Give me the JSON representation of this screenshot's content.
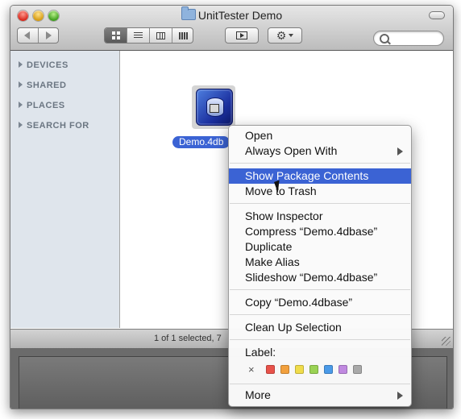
{
  "window": {
    "title": "UnitTester Demo"
  },
  "toolbar": {
    "back_icon": "back-arrow-icon",
    "forward_icon": "forward-arrow-icon",
    "view_modes": [
      "icon-view",
      "list-view",
      "column-view",
      "coverflow-view"
    ],
    "selected_view": "icon-view",
    "quicklook_icon": "quicklook-icon",
    "action_icon": "gear-icon",
    "search_placeholder": ""
  },
  "sidebar": {
    "items": [
      {
        "label": "DEVICES"
      },
      {
        "label": "SHARED"
      },
      {
        "label": "PLACES"
      },
      {
        "label": "SEARCH FOR"
      }
    ]
  },
  "content": {
    "file": {
      "label": "Demo.4db",
      "icon": "4d-database-icon"
    }
  },
  "status": {
    "text": "1 of 1 selected, 7"
  },
  "context_menu": {
    "open": "Open",
    "always_open_with": "Always Open With",
    "show_package_contents": "Show Package Contents",
    "move_to_trash": "Move to Trash",
    "show_inspector": "Show Inspector",
    "compress": "Compress “Demo.4dbase”",
    "duplicate": "Duplicate",
    "make_alias": "Make Alias",
    "slideshow": "Slideshow “Demo.4dbase”",
    "copy": "Copy “Demo.4dbase”",
    "clean_up_selection": "Clean Up Selection",
    "label_title": "Label:",
    "label_none": "×",
    "label_colors": [
      "#e8524a",
      "#f2a03d",
      "#f0dc4b",
      "#9ad254",
      "#4a9ae8",
      "#c089e0",
      "#a9a9a9"
    ],
    "more": "More",
    "highlighted_item": "Show Package Contents"
  }
}
